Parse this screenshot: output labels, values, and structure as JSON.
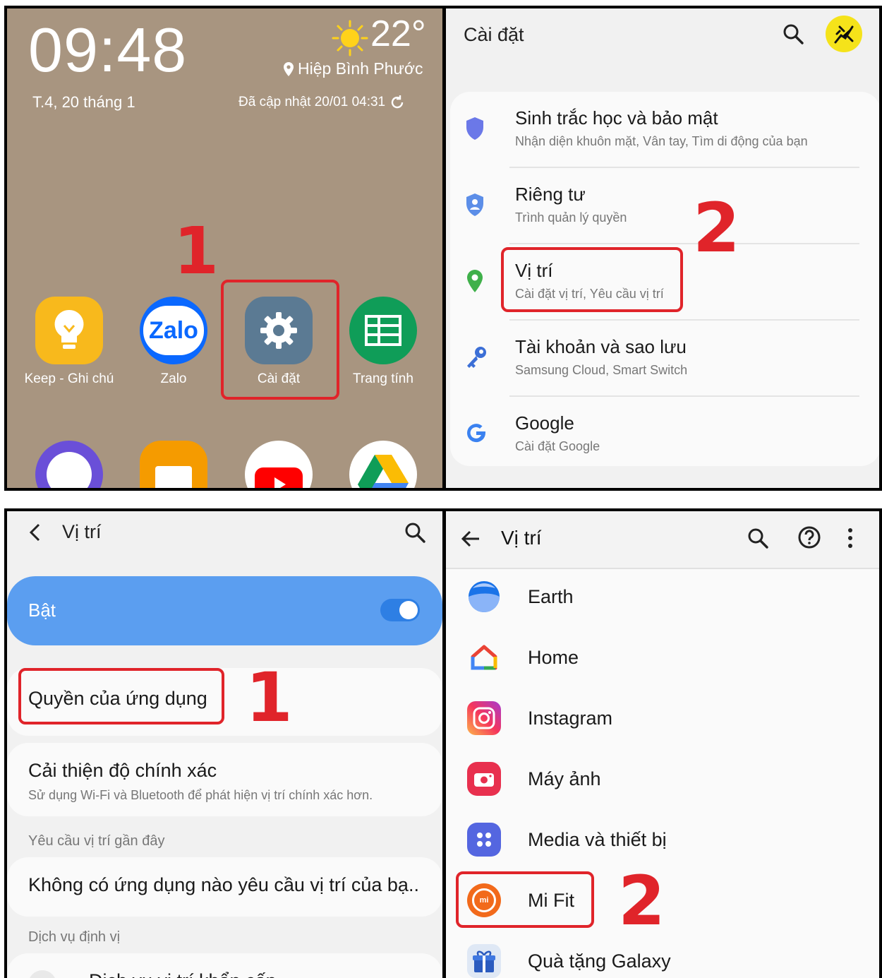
{
  "home": {
    "time": "09:48",
    "date": "T.4, 20 tháng 1",
    "temperature": "22°",
    "location": "Hiệp Bình Phước",
    "updated": "Đã cập nhật 20/01 04:31",
    "step_number": "1",
    "apps": [
      {
        "label": "Keep - Ghi chú"
      },
      {
        "label": "Zalo",
        "logo_text": "Zalo"
      },
      {
        "label": "Cài đặt"
      },
      {
        "label": "Trang tính"
      }
    ]
  },
  "settings": {
    "title": "Cài đặt",
    "step_number": "2",
    "items": [
      {
        "title": "Sinh trắc học và bảo mật",
        "subtitle": "Nhận diện khuôn mặt, Vân tay, Tìm di động của bạn"
      },
      {
        "title": "Riêng tư",
        "subtitle": "Trình quản lý quyền"
      },
      {
        "title": "Vị trí",
        "subtitle": "Cài đặt vị trí, Yêu cầu vị trí"
      },
      {
        "title": "Tài khoản và sao lưu",
        "subtitle": "Samsung Cloud, Smart Switch"
      },
      {
        "title": "Google",
        "subtitle": "Cài đặt Google"
      }
    ]
  },
  "location": {
    "title": "Vị trí",
    "master_label": "Bật",
    "master_on": true,
    "app_permissions": "Quyền của ứng dụng",
    "step_number": "1",
    "improve_title": "Cải thiện độ chính xác",
    "improve_subtitle": "Sử dụng Wi-Fi và Bluetooth để phát hiện vị trí chính xác hơn.",
    "recent_header": "Yêu cầu vị trí gần đây",
    "recent_none": "Không có ứng dụng nào yêu cầu vị trí của bạ..",
    "services_header": "Dịch vụ định vị",
    "services_first": "Dịch vụ vị trí khẩn cấp"
  },
  "app_list": {
    "title": "Vị trí",
    "step_number": "2",
    "apps": [
      {
        "label": "Earth",
        "icon": "earth-icon"
      },
      {
        "label": "Home",
        "icon": "home-icon"
      },
      {
        "label": "Instagram",
        "icon": "instagram-icon"
      },
      {
        "label": "Máy ảnh",
        "icon": "camera-icon"
      },
      {
        "label": "Media và thiết bị",
        "icon": "media-devices-icon"
      },
      {
        "label": "Mi Fit",
        "icon": "mi-fit-icon",
        "badge": "mi"
      },
      {
        "label": "Quà tặng Galaxy",
        "icon": "galaxy-gifts-icon"
      }
    ]
  },
  "colors": {
    "highlight": "#e0242a",
    "home_bg": "#a89580",
    "toggle_bar": "#5b9ef0"
  }
}
